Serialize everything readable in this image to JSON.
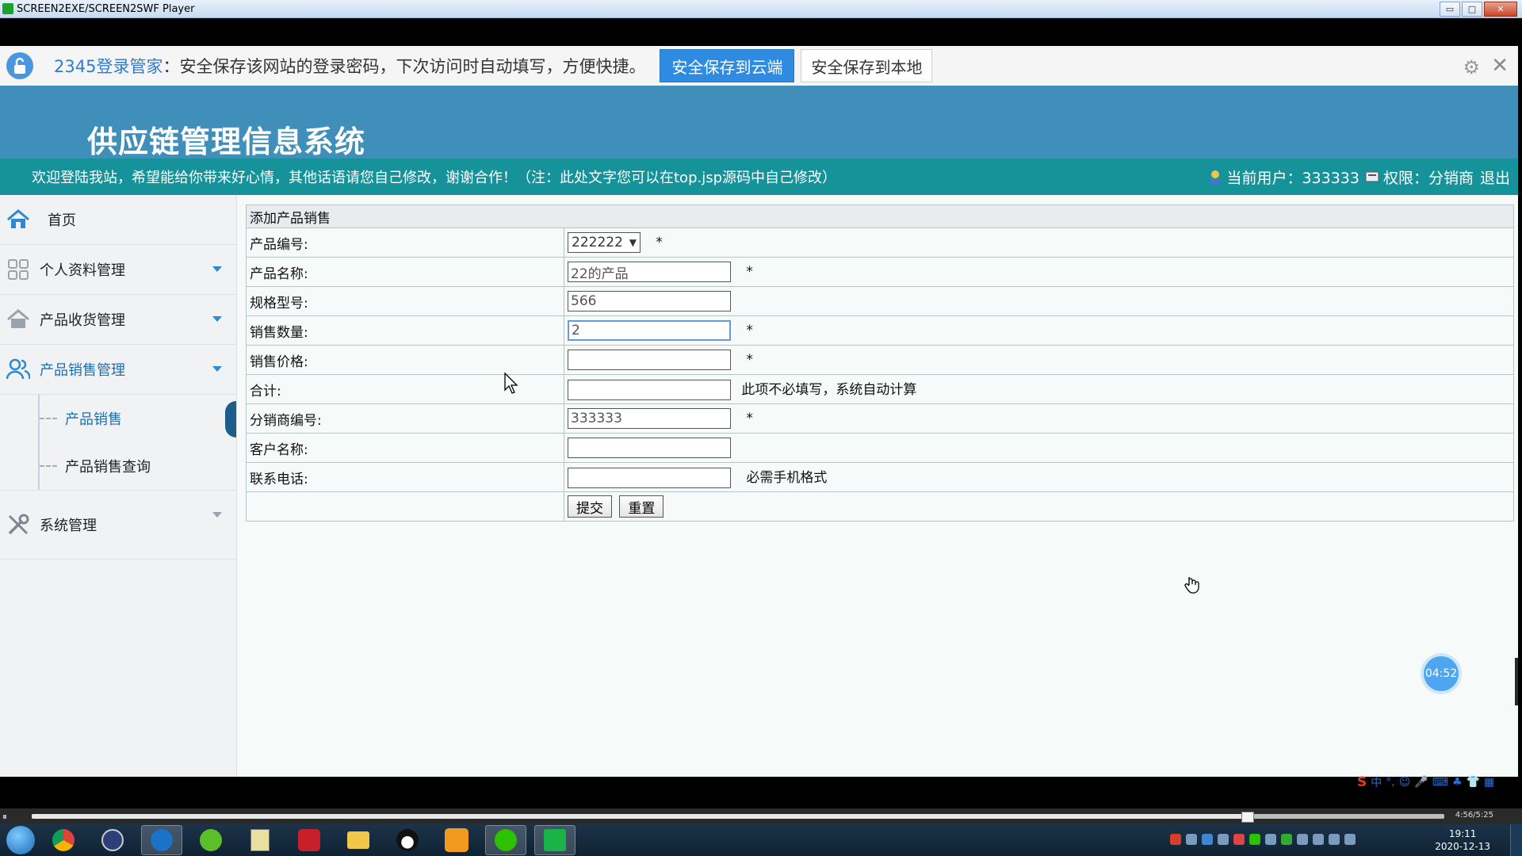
{
  "player": {
    "title": "SCREEN2EXE/SCREEN2SWF Player",
    "minimize": "▭",
    "maximize": "□",
    "close": "✕",
    "pause_glyph": "⏸",
    "progress": 0.86,
    "time": "4:56/5:25"
  },
  "pwbar": {
    "brand": "2345登录管家",
    "message": "：安全保存该网站的登录密码，下次访问时自动填写，方便快捷。",
    "save_cloud": "安全保存到云端",
    "save_local": "安全保存到本地",
    "gear_glyph": "⚙",
    "close_glyph": "✕"
  },
  "banner": {
    "title": "供应链管理信息系统"
  },
  "welcome": {
    "text": "欢迎登陆我站，希望能给你带来好心情，其他话语请您自己修改，谢谢合作！（注：此处文字您可以在top.jsp源码中自己修改）",
    "user": "当前用户：333333",
    "permission": "权限：分销商",
    "logout": "退出"
  },
  "sidebar": {
    "home": "首页",
    "items": [
      {
        "label": "个人资料管理"
      },
      {
        "label": "产品收货管理"
      },
      {
        "label": "产品销售管理"
      }
    ],
    "subitems": [
      {
        "label": "产品销售"
      },
      {
        "label": "产品销售查询"
      }
    ],
    "system": "系统管理"
  },
  "form": {
    "caption": "添加产品销售",
    "product_code": {
      "label": "产品编号:",
      "value": "222222",
      "required": "*"
    },
    "product_name": {
      "label": "产品名称:",
      "value": "22的产品",
      "required": "*"
    },
    "spec": {
      "label": "规格型号:",
      "value": "566"
    },
    "quantity": {
      "label": "销售数量:",
      "value": "2",
      "required": "*"
    },
    "price": {
      "label": "销售价格:",
      "value": "",
      "required": "*"
    },
    "total": {
      "label": "合计:",
      "value": "",
      "hint": "此项不必填写，系统自动计算"
    },
    "distributor": {
      "label": "分销商编号:",
      "value": "333333",
      "required": "*"
    },
    "customer": {
      "label": "客户名称:",
      "value": ""
    },
    "phone": {
      "label": "联系电话:",
      "value": "",
      "hint": "必需手机格式"
    },
    "submit": "提交",
    "reset": "重置"
  },
  "timer": "04:52",
  "ime": {
    "logo": "S",
    "mode": "中"
  },
  "taskbar": {
    "time": "19:11",
    "date": "2020-12-13"
  },
  "colors": {
    "banner": "#3f8fba",
    "welcome_bar": "#16939a",
    "accent": "#2f8be0"
  }
}
